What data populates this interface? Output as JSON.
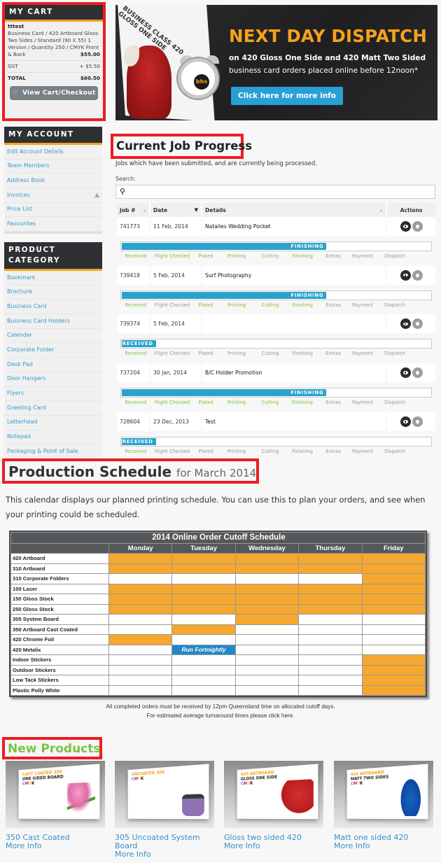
{
  "cart": {
    "title": "MY CART",
    "item_name": "tttest",
    "item_desc": "Business Card / 420 Artboard Gloss Two Sides / Standard (90 X 55) 1 Version / Quantity 250 / CMYK Front & Back",
    "item_price": "$55.00",
    "gst_label": "GST",
    "gst_value": "+ $5.50",
    "total_label": "TOTAL",
    "total_value": "$60.50",
    "checkout_label": "View Cart/Checkout",
    "checkout_icon": "cart-icon"
  },
  "account": {
    "title": "MY ACCOUNT",
    "items": [
      {
        "label": "Edit Account Details"
      },
      {
        "label": "Team Members"
      },
      {
        "label": "Address Book"
      },
      {
        "label": "Invoices",
        "icon": "warning-icon"
      },
      {
        "label": "Price List"
      },
      {
        "label": "Favourites"
      }
    ]
  },
  "category": {
    "title": "PRODUCT CATEGORY",
    "items": [
      "Bookmark",
      "Brochure",
      "Business Card",
      "Business Card Holders",
      "Calendar",
      "Corporate Folder",
      "Desk Pad",
      "Door Hangers",
      "Flyers",
      "Greeting Card",
      "Letterhead",
      "Notepad",
      "Packaging & Point of Sale"
    ]
  },
  "banner": {
    "title": "NEXT DAY DISPATCH",
    "line1": "on 420 Gloss One Side and 420 Matt Two Sided",
    "line2": "business card orders placed online before 12noon*",
    "button": "Click here for more info",
    "card_text": "BUSINESS CLASS 420 GLOSS ONE SIDE",
    "clock_logo": "bhs",
    "accent": "#f6a21a",
    "button_color": "#2a9fd6"
  },
  "jobs": {
    "title": "Current Job Progress",
    "description": "Jobs which have been submitted, and are currently being processed.",
    "search_label": "Search:",
    "search_value": "",
    "search_placeholder": "",
    "columns": [
      "Job #",
      "Date",
      "Details",
      "Actions"
    ],
    "sorted_column": "Date",
    "stage_names": [
      "Received",
      "Flight Checked",
      "Plated",
      "Printing",
      "Cutting",
      "Finishing",
      "Extras",
      "Payment",
      "Dispatch"
    ],
    "rows": [
      {
        "job": "741773",
        "date": "11 Feb, 2014",
        "details": "Natalies Wedding Pocket",
        "status": "FINISHING",
        "progress": 0.66,
        "stages_done": [
          true,
          true,
          true,
          true,
          true,
          true,
          false,
          false,
          false
        ]
      },
      {
        "job": "739418",
        "date": "5 Feb, 2014",
        "details": "Surf Photography",
        "status": "FINISHING",
        "progress": 0.66,
        "stages_done": [
          true,
          false,
          true,
          true,
          true,
          true,
          false,
          false,
          false
        ]
      },
      {
        "job": "739374",
        "date": "5 Feb, 2014",
        "details": "",
        "status": "RECEIVED",
        "progress": 0.11,
        "stages_done": [
          true,
          false,
          false,
          false,
          false,
          false,
          false,
          false,
          false
        ]
      },
      {
        "job": "737204",
        "date": "30 Jan, 2014",
        "details": "B/C Holder Promotion",
        "status": "FINISHING",
        "progress": 0.66,
        "stages_done": [
          true,
          true,
          true,
          true,
          true,
          true,
          false,
          false,
          false
        ]
      },
      {
        "job": "728604",
        "date": "23 Dec, 2013",
        "details": "Test",
        "status": "RECEIVED",
        "progress": 0.11,
        "stages_done": [
          true,
          false,
          false,
          false,
          false,
          false,
          false,
          false,
          false
        ]
      }
    ],
    "done_color": "#7dc242",
    "bar_color": "#2aa3cc"
  },
  "schedule": {
    "title": "Production Schedule",
    "title_suffix": "for March 2014",
    "description": "This calendar displays our planned printing schedule. You can use this to plan your orders, and see when your printing could be scheduled.",
    "table_title": "2014 Online Order Cutoff Schedule",
    "days": [
      "Monday",
      "Tuesday",
      "Wednesday",
      "Thursday",
      "Friday"
    ],
    "rows": [
      {
        "stock": "420 Artboard",
        "days": [
          1,
          1,
          1,
          1,
          1
        ]
      },
      {
        "stock": "310 Artboard",
        "days": [
          1,
          1,
          1,
          1,
          1
        ]
      },
      {
        "stock": "310 Corporate Folders",
        "days": [
          0,
          0,
          0,
          0,
          1
        ]
      },
      {
        "stock": "100 Laser",
        "days": [
          1,
          1,
          1,
          1,
          1
        ]
      },
      {
        "stock": "150 Gloss Stock",
        "days": [
          1,
          1,
          1,
          1,
          1
        ]
      },
      {
        "stock": "250 Gloss Stock",
        "days": [
          1,
          1,
          1,
          1,
          1
        ]
      },
      {
        "stock": "305 System Board",
        "days": [
          0,
          0,
          1,
          0,
          0
        ]
      },
      {
        "stock": "350 Artboard Cast Coated",
        "days": [
          0,
          1,
          0,
          0,
          0
        ]
      },
      {
        "stock": "420 Chrome Foil",
        "days": [
          1,
          0,
          0,
          0,
          0
        ]
      },
      {
        "stock": "420 Metalix",
        "days": [
          0,
          "Run Fortnightly",
          0,
          0,
          0
        ]
      },
      {
        "stock": "Indoor Stickers",
        "days": [
          0,
          0,
          0,
          0,
          1
        ]
      },
      {
        "stock": "Outdoor Stickers",
        "days": [
          0,
          0,
          0,
          0,
          1
        ]
      },
      {
        "stock": "Low Tack Stickers",
        "days": [
          0,
          0,
          0,
          0,
          1
        ]
      },
      {
        "stock": "Plastic Polly White",
        "days": [
          0,
          0,
          0,
          0,
          1
        ]
      }
    ],
    "footnote1": "All completed orders must be received by 12pm Queensland time on allocated cutoff days.",
    "footnote2": "For estimated average turnaround times please click here.",
    "cutoff_color": "#f6a72f",
    "note_color": "#2387c9"
  },
  "new_products": {
    "title": "New Products",
    "more_label": "More Info",
    "items": [
      {
        "name": "350 Cast Coated",
        "card_line1": "CAST COATED 350",
        "card_line2": "ONE SIDED BOARD",
        "image": "tulips"
      },
      {
        "name": "305 Uncoated System Board",
        "card_line1": "UNCOATED 305",
        "card_line2": "",
        "image": "handbag"
      },
      {
        "name": "Gloss two sided 420",
        "card_line1": "420 ARTBOARD",
        "card_line2": "GLOSS ONE SIDE",
        "image": "parrot"
      },
      {
        "name": "Matt one sided 420",
        "card_line1": "420 ARTBOARD",
        "card_line2": "MATT TWO SIDES",
        "image": "peacock"
      }
    ]
  }
}
